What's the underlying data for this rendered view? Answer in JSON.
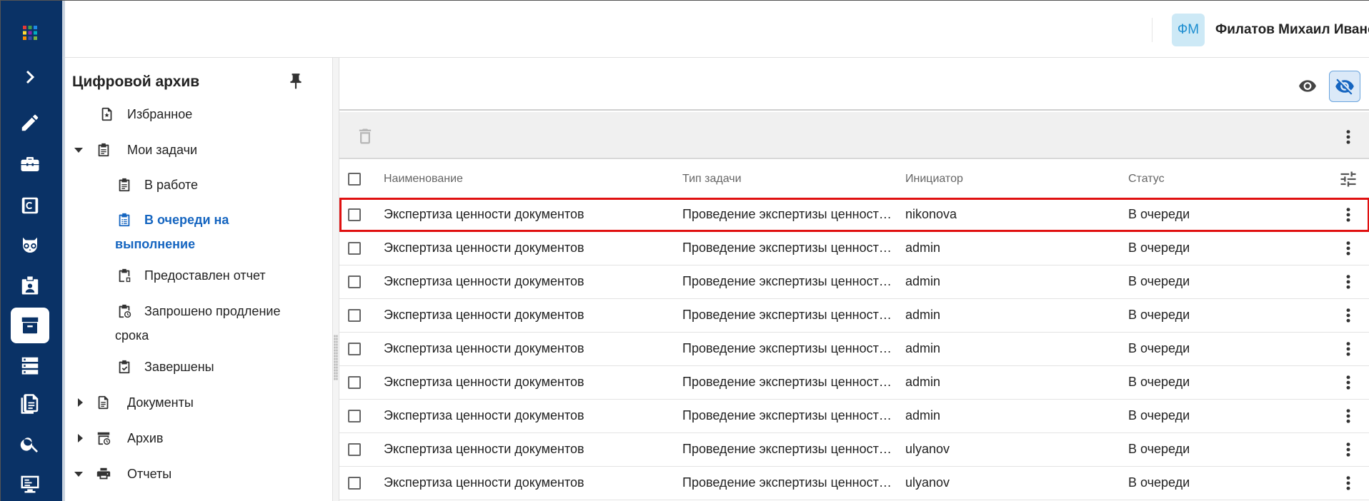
{
  "header": {
    "avatar_initials": "ФМ",
    "user_name": "Филатов Михаил Иванович"
  },
  "rail": {
    "items": [
      {
        "icon": "apps-grid-icon"
      },
      {
        "icon": "expand-chevron-icon"
      },
      {
        "icon": "pencil-icon"
      },
      {
        "icon": "toolbox-icon"
      },
      {
        "icon": "c-badge-icon"
      },
      {
        "icon": "owl-icon"
      },
      {
        "icon": "badge-icon"
      },
      {
        "icon": "archive-box-icon",
        "active": true
      },
      {
        "icon": "server-list-icon"
      },
      {
        "icon": "documents-icon"
      },
      {
        "icon": "search-icon"
      },
      {
        "icon": "monitor-icon"
      }
    ]
  },
  "sidebar": {
    "title": "Цифровой архив",
    "items": [
      {
        "label": "Избранное"
      },
      {
        "label": "Мои задачи"
      },
      {
        "label": "В работе"
      },
      {
        "label": "В очереди на",
        "label2": "выполнение"
      },
      {
        "label": "Предоставлен отчет"
      },
      {
        "label": "Запрошено продление",
        "label2": "срока"
      },
      {
        "label": "Завершены"
      },
      {
        "label": "Документы"
      },
      {
        "label": "Архив"
      },
      {
        "label": "Отчеты"
      }
    ]
  },
  "table": {
    "columns": [
      "Наименование",
      "Тип задачи",
      "Инициатор",
      "Статус"
    ],
    "rows": [
      {
        "name": "Экспертиза ценности документов",
        "type": "Проведение экспертизы ценности документов",
        "initiator": "nikonova",
        "status": "В очереди"
      },
      {
        "name": "Экспертиза ценности документов",
        "type": "Проведение экспертизы ценности документов",
        "initiator": "admin",
        "status": "В очереди"
      },
      {
        "name": "Экспертиза ценности документов",
        "type": "Проведение экспертизы ценности документов",
        "initiator": "admin",
        "status": "В очереди"
      },
      {
        "name": "Экспертиза ценности документов",
        "type": "Проведение экспертизы ценности документов",
        "initiator": "admin",
        "status": "В очереди"
      },
      {
        "name": "Экспертиза ценности документов",
        "type": "Проведение экспертизы ценности документов",
        "initiator": "admin",
        "status": "В очереди"
      },
      {
        "name": "Экспертиза ценности документов",
        "type": "Проведение экспертизы ценности документов",
        "initiator": "admin",
        "status": "В очереди"
      },
      {
        "name": "Экспертиза ценности документов",
        "type": "Проведение экспертизы ценности документов",
        "initiator": "admin",
        "status": "В очереди"
      },
      {
        "name": "Экспертиза ценности документов",
        "type": "Проведение экспертизы ценности документов",
        "initiator": "ulyanov",
        "status": "В очереди"
      },
      {
        "name": "Экспертиза ценности документов",
        "type": "Проведение экспертизы ценности документов",
        "initiator": "ulyanov",
        "status": "В очереди"
      }
    ]
  },
  "colors": {
    "rail_bg": "#0a3266",
    "accent": "#1565c0",
    "highlight": "#e01010"
  }
}
